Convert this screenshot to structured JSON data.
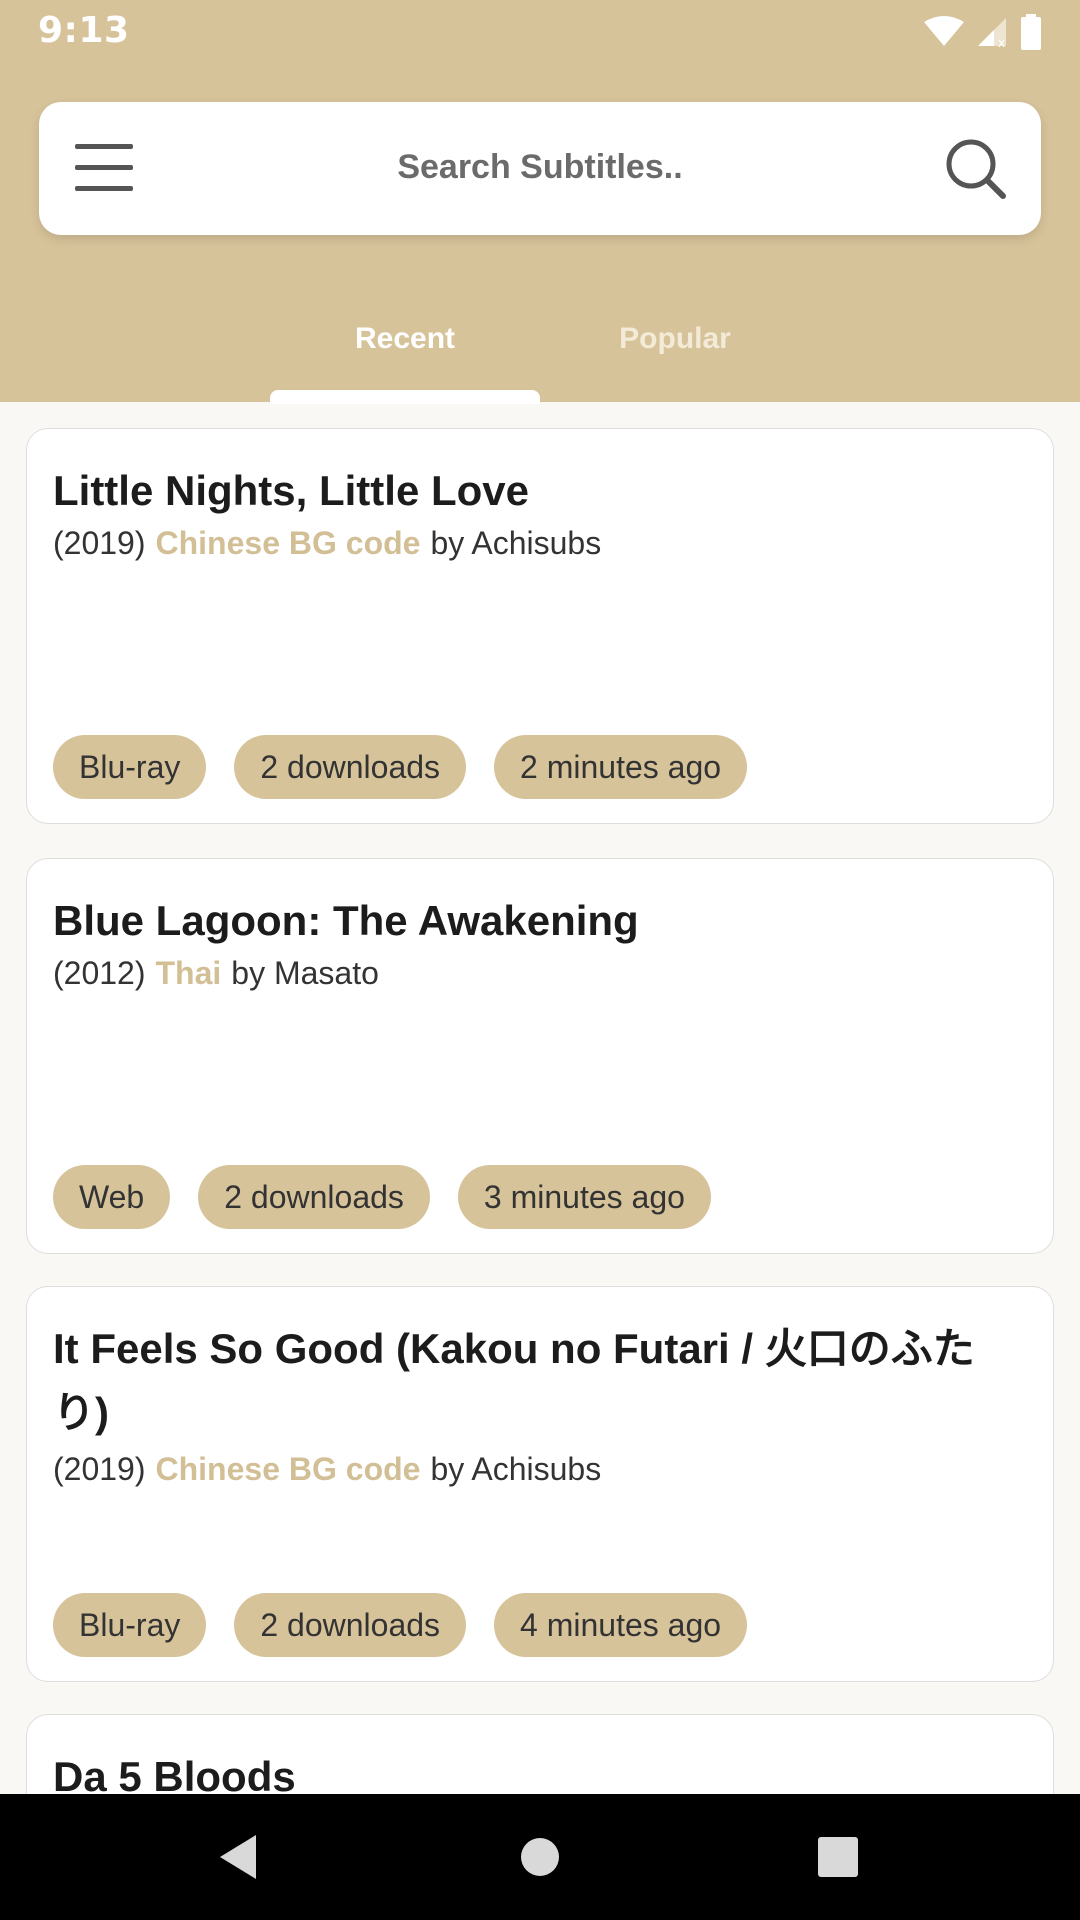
{
  "status_bar": {
    "time": "9:13"
  },
  "search": {
    "placeholder": "Search Subtitles.."
  },
  "tabs": [
    {
      "label": "Recent",
      "active": true
    },
    {
      "label": "Popular",
      "active": false
    }
  ],
  "subtitles": [
    {
      "title": "Little Nights, Little Love",
      "year": "(2019)",
      "language": "Chinese BG code",
      "uploader": "by Achisubs",
      "source": "Blu-ray",
      "downloads": "2 downloads",
      "time_ago": "2 minutes ago"
    },
    {
      "title": "Blue Lagoon: The Awakening",
      "year": "(2012)",
      "language": "Thai",
      "uploader": "by Masato",
      "source": "Web",
      "downloads": "2 downloads",
      "time_ago": "3 minutes ago"
    },
    {
      "title": "It Feels So Good (Kakou no Futari / 火口のふたり)",
      "year": "(2019)",
      "language": "Chinese BG code",
      "uploader": "by Achisubs",
      "source": "Blu-ray",
      "downloads": "2 downloads",
      "time_ago": "4 minutes ago"
    },
    {
      "title": "Da 5 Bloods"
    }
  ],
  "colors": {
    "accent": "#d7c39a",
    "language_text": "#d2bf96",
    "background": "#f9f8f5"
  }
}
